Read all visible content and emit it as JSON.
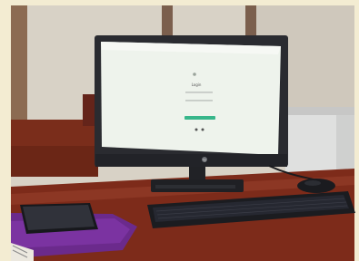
{
  "photo": {
    "kind": "photo of a desktop computer workstation",
    "colors": {
      "frame": "#f3ecd2",
      "wall": "#d9d3c7",
      "wood_desk": "#7b2a18",
      "monitor_bezel": "#2a2b30",
      "screen": "#eef3ec",
      "screen_accent_green": "#37b68a",
      "keyboard": "#1b1c20",
      "purple_folder": "#6b2a8c",
      "printer": "#dfe0df"
    },
    "objects": [
      {
        "name": "monitor",
        "brand_logo": "hp"
      },
      {
        "name": "keyboard"
      },
      {
        "name": "mouse"
      },
      {
        "name": "smartphone"
      },
      {
        "name": "purple-folder"
      },
      {
        "name": "printer"
      }
    ],
    "screen": {
      "page_title": "Login",
      "primary_button_color": "#37b68a"
    }
  }
}
